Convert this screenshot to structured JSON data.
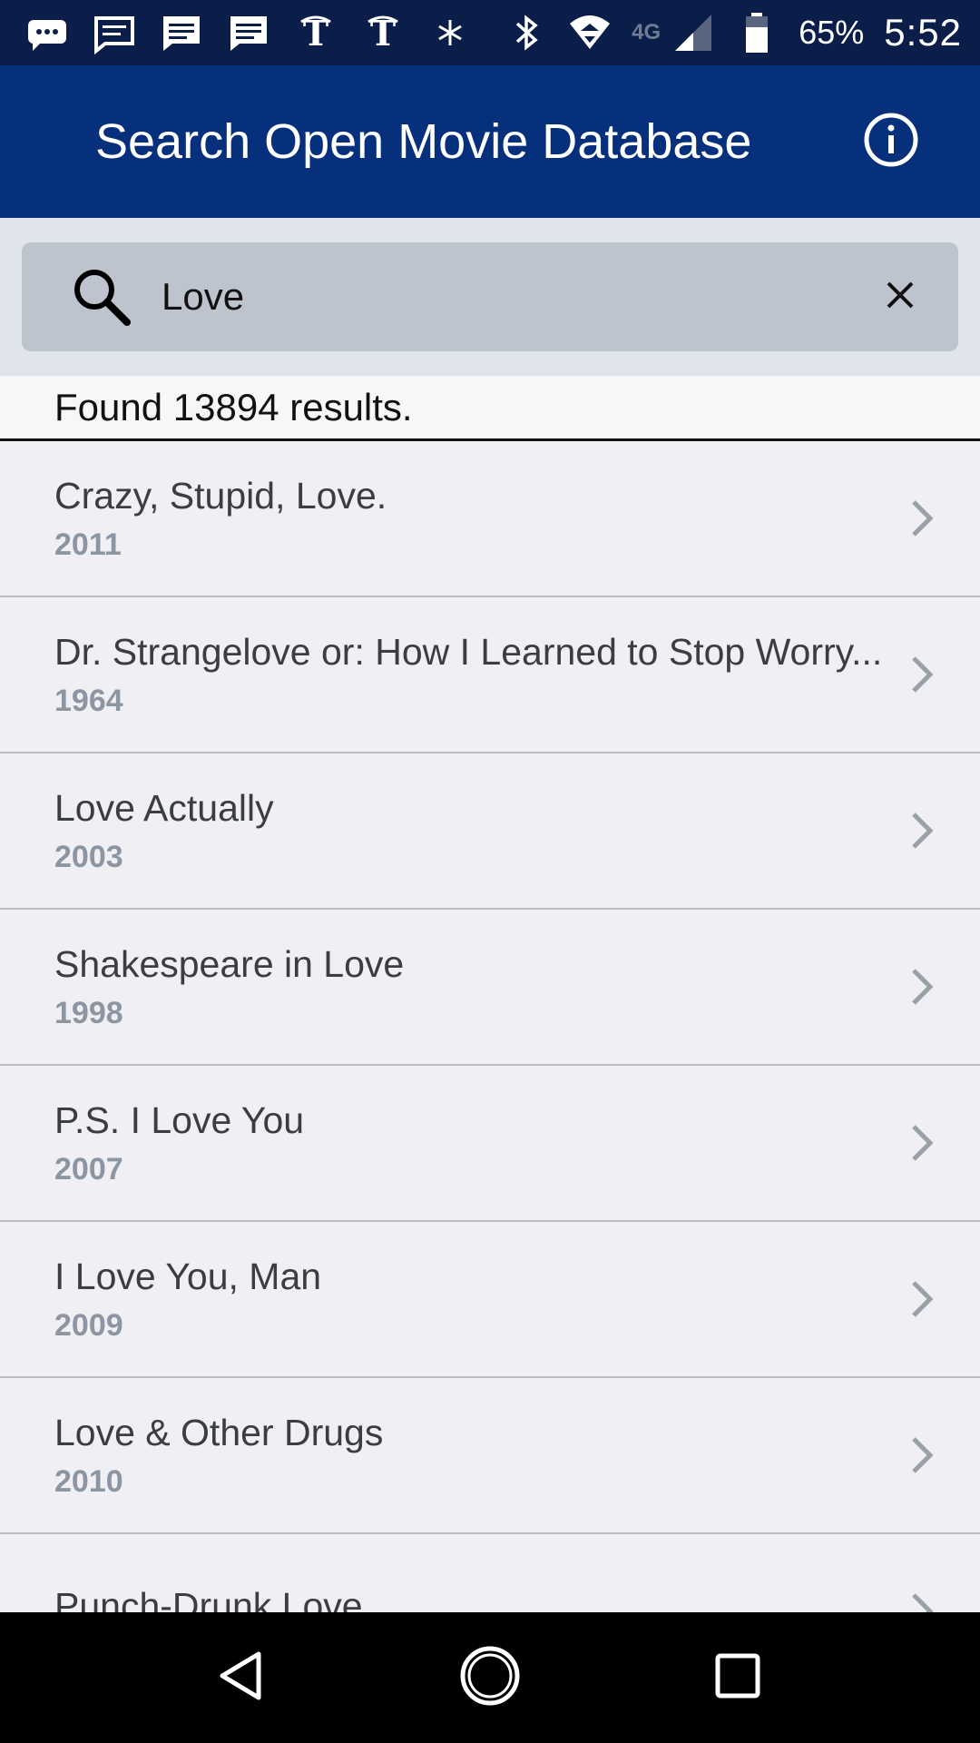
{
  "status_bar": {
    "battery_percent": "65%",
    "time": "5:52",
    "network_label": "4G",
    "icons": [
      "chat-bubble-icon",
      "message-icon",
      "message-icon",
      "message-icon",
      "nyt-icon",
      "nyt-icon",
      "snowflake-icon",
      "bluetooth-icon",
      "wifi-icon",
      "lte-icon",
      "signal-icon",
      "battery-icon"
    ]
  },
  "app_bar": {
    "title": "Search Open Movie Database",
    "info_icon": "info-icon"
  },
  "search": {
    "value": "Love",
    "search_icon": "search-icon",
    "clear_icon": "close-icon"
  },
  "results": {
    "count_text": "Found 13894 results.",
    "items": [
      {
        "title": "Crazy, Stupid, Love.",
        "year": "2011"
      },
      {
        "title": "Dr. Strangelove or: How I Learned to Stop Worry...",
        "year": "1964"
      },
      {
        "title": "Love Actually",
        "year": "2003"
      },
      {
        "title": "Shakespeare in Love",
        "year": "1998"
      },
      {
        "title": "P.S. I Love You",
        "year": "2007"
      },
      {
        "title": "I Love You, Man",
        "year": "2009"
      },
      {
        "title": "Love & Other Drugs",
        "year": "2010"
      },
      {
        "title": "Punch-Drunk Love",
        "year": ""
      }
    ]
  },
  "nav_bar": {
    "buttons": [
      "back-icon",
      "home-icon",
      "recents-icon"
    ]
  },
  "colors": {
    "status_bar_bg": "#0b1e4a",
    "app_bar_bg": "#062f7c",
    "search_area_bg": "#e0e5ec",
    "search_box_bg": "#bdc4cd",
    "list_bg": "#efeff4",
    "year_text": "#8c95a1"
  }
}
